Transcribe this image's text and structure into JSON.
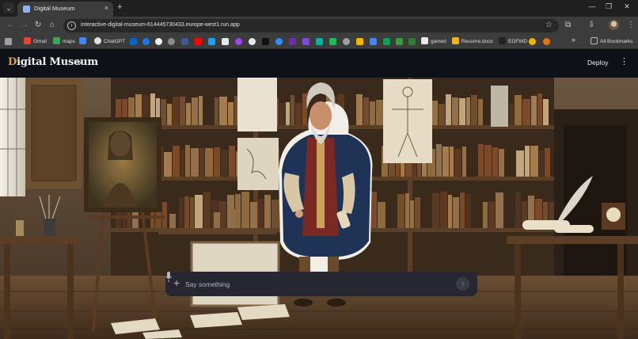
{
  "browser": {
    "tab_title": "Digital Museum",
    "new_tab_glyph": "+",
    "tab_close_glyph": "×",
    "url": "interactive-digital-museum-614445730433.europe-west1.run.app",
    "window_controls": {
      "minimize": "—",
      "maximize": "❐",
      "close": "✕"
    }
  },
  "bookmarks": {
    "gmail": "Gmail",
    "maps": "maps",
    "chatgpt": "ChatGPT",
    "gamed": "gamed",
    "resume": "Resume.docx",
    "egfwd": "EGFWD",
    "all_bookmarks": "All Bookmarks",
    "overflow": "»"
  },
  "app": {
    "logo_initial": "D",
    "logo_rest": "igital Museum",
    "sidebar_toggle": "»",
    "deploy_label": "Deploy",
    "menu_glyph": "⋮"
  },
  "chat": {
    "placeholder": "Say something",
    "plus_glyph": "+",
    "send_glyph": "↑"
  },
  "colors": {
    "app_bg": "#0e1117",
    "chat_bg": "#262730",
    "accent_logo": "#d9a23a"
  },
  "icons": {
    "search_tabs": "chevron-down-icon",
    "back": "arrow-left-icon",
    "forward": "arrow-right-icon",
    "reload": "reload-icon",
    "home": "home-icon",
    "site_info": "info-icon",
    "bookmark_star": "star-icon",
    "extensions": "puzzle-icon",
    "mic": "microphone-icon",
    "send": "arrow-up-icon"
  }
}
